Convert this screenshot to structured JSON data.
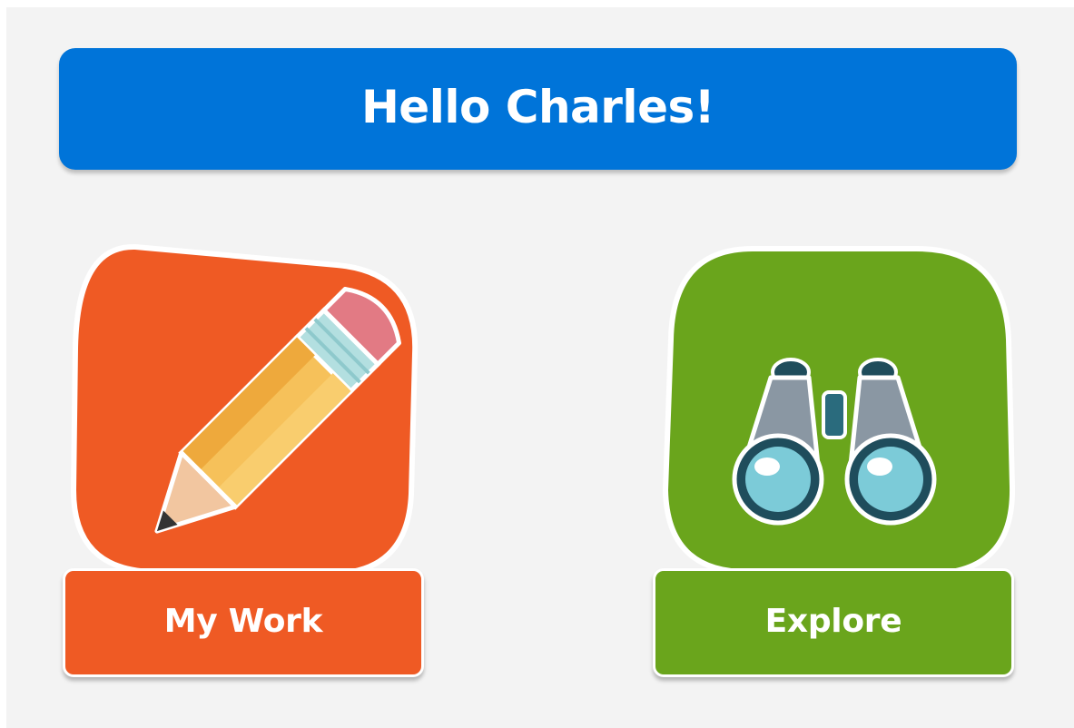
{
  "greeting": {
    "text": "Hello Charles!"
  },
  "tiles": [
    {
      "id": "my-work",
      "label": "My Work",
      "icon": "pencil-icon",
      "color": "#ef5a24"
    },
    {
      "id": "explore",
      "label": "Explore",
      "icon": "binoculars-icon",
      "color": "#6aa51c"
    }
  ],
  "colors": {
    "header": "#0074d9",
    "background": "#f3f3f3",
    "my_work": "#ef5a24",
    "explore": "#6aa51c"
  }
}
